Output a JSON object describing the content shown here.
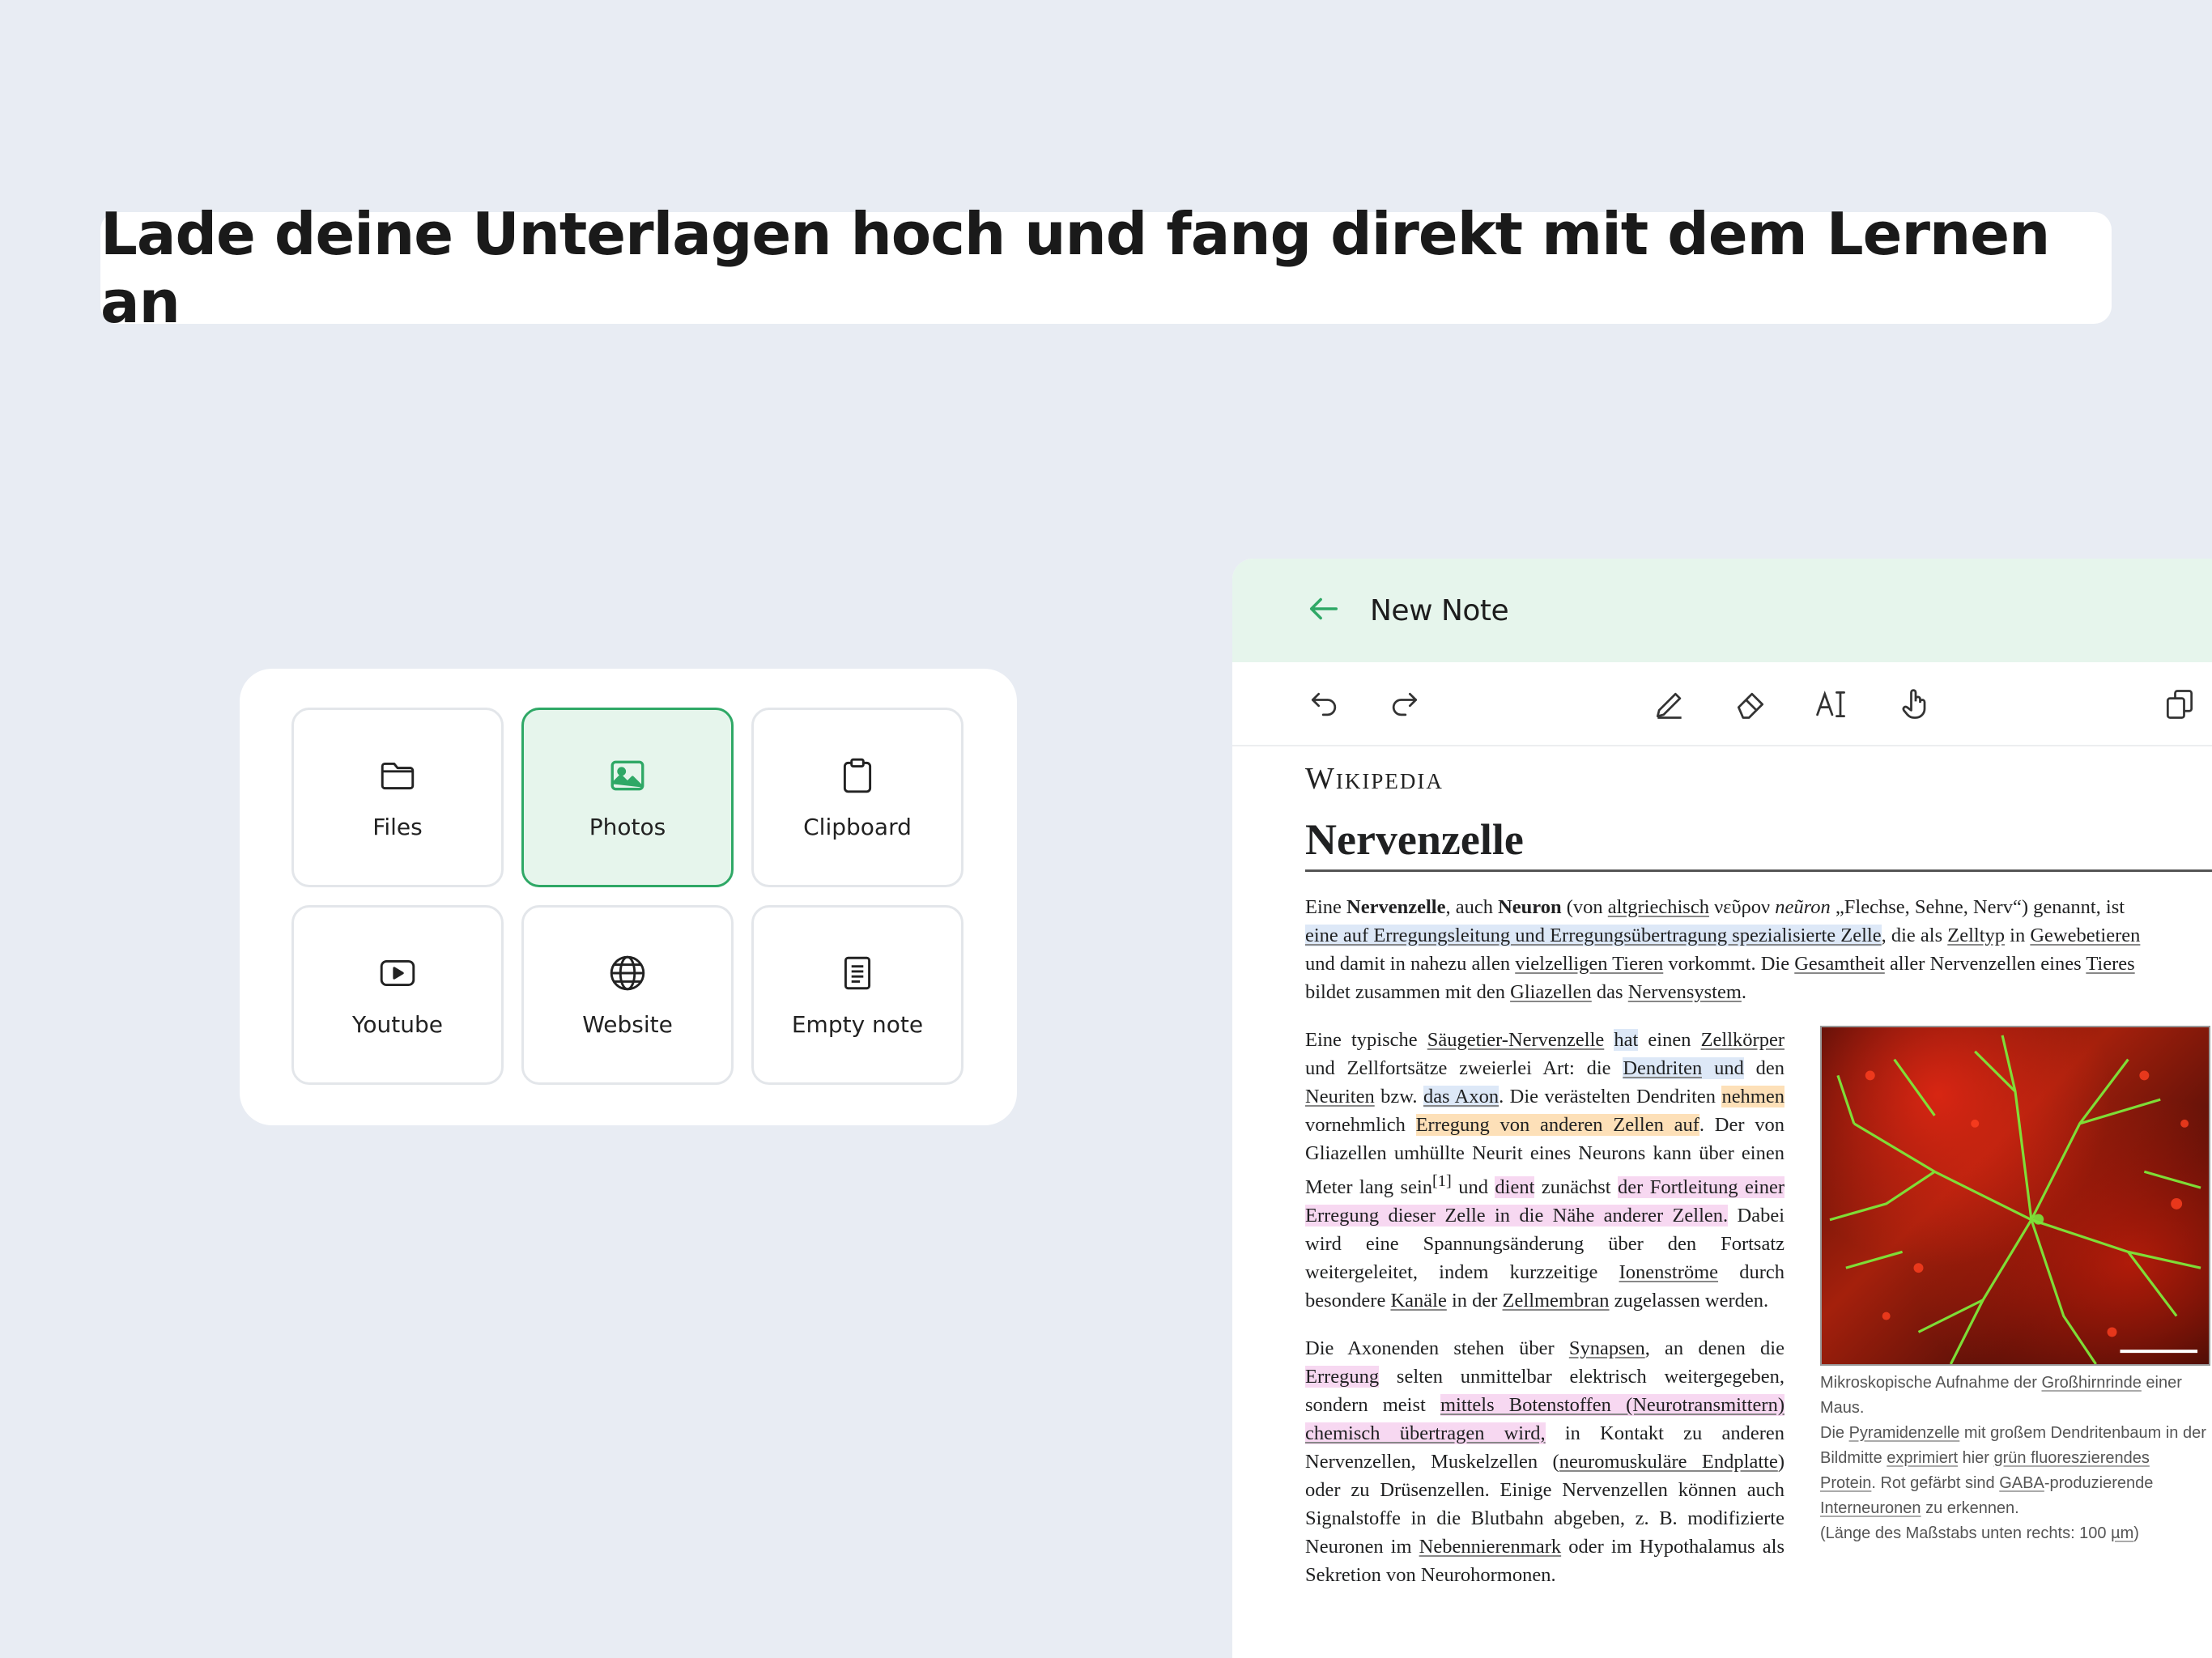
{
  "headline": "Lade deine Unterlagen hoch und fang direkt mit dem Lernen an",
  "picker": {
    "tiles": [
      {
        "label": "Files",
        "icon": "folder-icon"
      },
      {
        "label": "Photos",
        "icon": "image-icon",
        "selected": true
      },
      {
        "label": "Clipboard",
        "icon": "clipboard-icon"
      },
      {
        "label": "Youtube",
        "icon": "youtube-icon"
      },
      {
        "label": "Website",
        "icon": "globe-icon"
      },
      {
        "label": "Empty note",
        "icon": "document-icon"
      }
    ]
  },
  "note": {
    "title": "New Note",
    "toolbar": [
      "undo-icon",
      "redo-icon",
      "pen-icon",
      "eraser-icon",
      "text-cursor-icon",
      "hand-pointer-icon",
      "copy-icon"
    ],
    "doc": {
      "logo": "Wikipedia",
      "title": "Nervenzelle",
      "intro": {
        "l1": [
          "Eine ",
          "Nervenzelle",
          ", auch ",
          "Neuron",
          " (von ",
          "altgriechisch",
          " νεῦρον ",
          "neũron",
          " „Flechse, Sehne, Nerv“) genannt, ist"
        ],
        "l2": [
          "eine auf Erregungsleitung und Erregungsübertragung spezialisierte Zelle",
          ", die als ",
          "Zelltyp",
          " in ",
          "Gewebetieren"
        ],
        "l3": [
          "und damit in nahezu allen ",
          "vielzelligen Tieren",
          " vorkommt. Die ",
          "Gesamtheit",
          " aller Nervenzellen eines ",
          "Tieres"
        ],
        "l4": [
          "bildet zusammen mit den ",
          "Gliazellen",
          " das ",
          "Nervensystem",
          "."
        ]
      },
      "p1": {
        "a": "Eine typische ",
        "b": "Säugetier-Nervenzelle",
        "c": " ",
        "d": "hat",
        "e": " einen ",
        "f": "Zellkörper",
        "g": " und Zellfortsätze zweierlei Art: die ",
        "h": "Dendriten",
        "h2": " und",
        "i": " den ",
        "j": "Neuriten",
        "k": " bzw. ",
        "l": "das Axon",
        "m": ". Die verästelten Dendriten ",
        "n": "nehmen",
        "o": " vornehmlich ",
        "p": "Erregung von anderen Zellen auf",
        "q": ". Der von Gliazellen umhüllte Neurit eines Neurons kann über einen Meter lang sein",
        "r": "[1]",
        "s": " und ",
        "t": "dient",
        "u": " zunächst ",
        "v": "der Fortleitung einer Erregung dieser Zelle in die Nähe anderer Zellen.",
        "w": " Dabei wird eine Spannungsänderung über den Fortsatz weitergeleitet, indem kurzzeitige ",
        "x": "Ionenströme",
        "y": " durch besondere ",
        "z": "Kanäle",
        "z1": " in der ",
        "z2": "Zellmembran",
        "z3": " zugelassen werden."
      },
      "p2": {
        "a": "Die Axonenden stehen über ",
        "b": "Synapsen",
        "c": ", an denen die ",
        "d": "Erregung",
        "e": " selten unmittelbar elektrisch weitergegeben, sondern meist ",
        "f": "mittels Botenstoffen (Neurotransmittern) chemisch übertragen wird,",
        "g": " in Kontakt zu anderen Nervenzellen, Muskelzellen (",
        "h": "neuromuskuläre Endplatte",
        "i": ") oder zu Drüsenzellen. Einige Nervenzellen können auch Signalstoffe in die Blutbahn abgeben, z. B. modifizierte Neuronen im ",
        "j": "Nebennierenmark",
        "k": " oder im Hypothalamus als Sekretion von Neurohormonen."
      },
      "caption": {
        "c1": "Mikroskopische Aufnahme der ",
        "c2": "Großhirnrinde",
        "c3": " einer Maus.",
        "c4": "Die ",
        "c5": "Pyramidenzelle",
        "c6": " mit großem Dendritenbaum in der Bildmitte ",
        "c7": "exprimiert",
        "c8": " hier ",
        "c9": "grün fluoreszierendes Protein",
        "c10": ". Rot gefärbt sind ",
        "c11": "GABA",
        "c12": "-produzierende ",
        "c13": "Interneuronen",
        "c14": " zu erkennen.",
        "c15": "(Länge des Maßstabs unten rechts: 100 ",
        "c16": "µm",
        "c17": ")"
      }
    }
  },
  "colors": {
    "accent": "#2fa866",
    "header_bg": "#e6f5ec",
    "page_bg": "#e8ecf3"
  }
}
